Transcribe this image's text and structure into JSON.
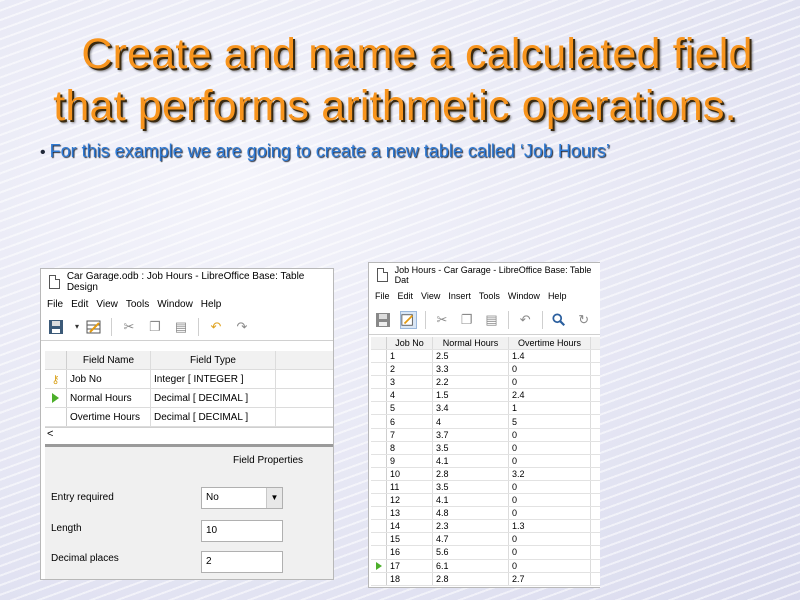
{
  "slide": {
    "title_line1": "Create and name a calculated field",
    "title_line2": "that performs arithmetic operations.",
    "bullet_marker": "•",
    "bullet_text": "For this example we are going to create a new table called ‘Job Hours’"
  },
  "colors": {
    "title": "#f7941d",
    "bullet": "#2f7ad4"
  },
  "table_design_window": {
    "title": "Car Garage.odb : Job Hours - LibreOffice Base: Table Design",
    "menu": [
      "File",
      "Edit",
      "View",
      "Tools",
      "Window",
      "Help"
    ],
    "toolbar_icons": [
      "save-icon",
      "dropdown-icon",
      "table-design-icon",
      "cut-icon",
      "copy-icon",
      "paste-icon",
      "undo-icon",
      "redo-icon"
    ],
    "columns": {
      "name": "Field Name",
      "type": "Field Type"
    },
    "fields": [
      {
        "marker": "key",
        "name": "Job No",
        "type": "Integer [ INTEGER ]"
      },
      {
        "marker": "current",
        "name": "Normal Hours",
        "type": "Decimal [ DECIMAL ]"
      },
      {
        "marker": "",
        "name": "Overtime Hours",
        "type": "Decimal [ DECIMAL ]"
      }
    ],
    "scroll_left": "<",
    "properties": {
      "title": "Field Properties",
      "entry_required_label": "Entry required",
      "entry_required_value": "No",
      "length_label": "Length",
      "length_value": "10",
      "decimal_places_label": "Decimal places",
      "decimal_places_value": "2"
    }
  },
  "data_view_window": {
    "title": "Job Hours - Car Garage - LibreOffice Base: Table Dat",
    "menu": [
      "File",
      "Edit",
      "View",
      "Insert",
      "Tools",
      "Window",
      "Help"
    ],
    "toolbar_icons": [
      "save-icon",
      "edit-icon",
      "cut-icon",
      "copy-icon",
      "paste-icon",
      "undo-icon",
      "find-icon",
      "refresh-icon"
    ],
    "columns": [
      "Job No",
      "Normal Hours",
      "Overtime Hours"
    ],
    "rows": [
      [
        "1",
        "2.5",
        "1.4"
      ],
      [
        "2",
        "3.3",
        "0"
      ],
      [
        "3",
        "2.2",
        "0"
      ],
      [
        "4",
        "1.5",
        "2.4"
      ],
      [
        "5",
        "3.4",
        "1"
      ],
      [
        "6",
        "4",
        "5"
      ],
      [
        "7",
        "3.7",
        "0"
      ],
      [
        "8",
        "3.5",
        "0"
      ],
      [
        "9",
        "4.1",
        "0"
      ],
      [
        "10",
        "2.8",
        "3.2"
      ],
      [
        "11",
        "3.5",
        "0"
      ],
      [
        "12",
        "4.1",
        "0"
      ],
      [
        "13",
        "4.8",
        "0"
      ],
      [
        "14",
        "2.3",
        "1.3"
      ],
      [
        "15",
        "4.7",
        "0"
      ],
      [
        "16",
        "5.6",
        "0"
      ],
      [
        "17",
        "6.1",
        "0"
      ],
      [
        "18",
        "2.8",
        "2.7"
      ]
    ],
    "current_row": "17"
  }
}
